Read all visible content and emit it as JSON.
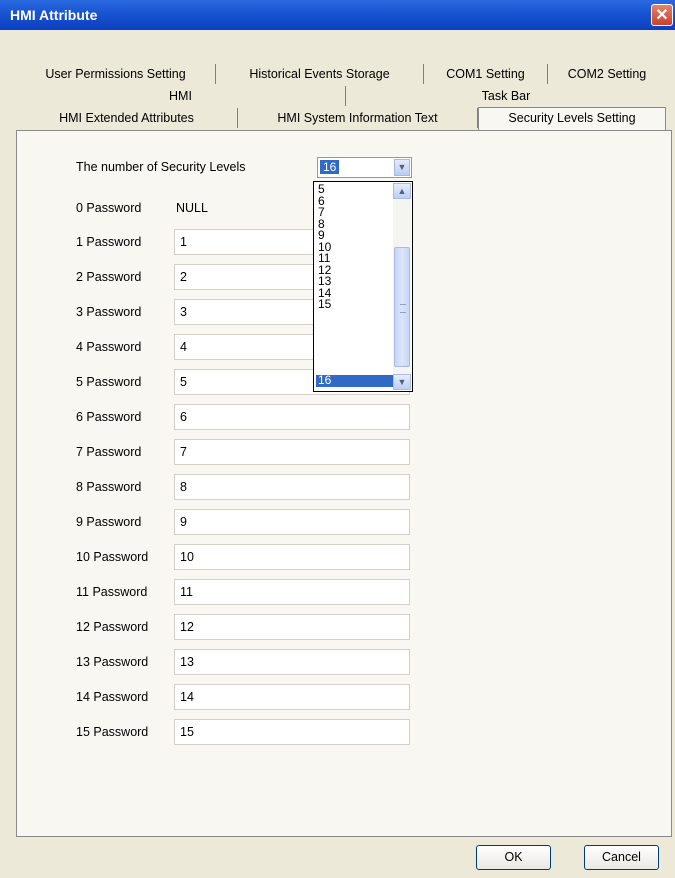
{
  "window": {
    "title": "HMI Attribute",
    "close_symbol": "✕"
  },
  "tabs": {
    "row1": [
      "User Permissions Setting",
      "Historical Events Storage",
      "COM1 Setting",
      "COM2 Setting"
    ],
    "row2": [
      "HMI",
      "Task Bar"
    ],
    "row3": [
      "HMI Extended Attributes",
      "HMI System Information Text",
      "Security Levels Setting"
    ],
    "active": "Security Levels Setting"
  },
  "security": {
    "levels_label": "The number of Security Levels",
    "levels_value": "16",
    "dropdown_options": [
      "5",
      "6",
      "7",
      "8",
      "9",
      "10",
      "11",
      "12",
      "13",
      "14",
      "15",
      "16"
    ],
    "dropdown_selected": "16",
    "password0_label": "0 Password",
    "password0_value": "NULL",
    "passwords": [
      {
        "label": "1 Password",
        "value": "1"
      },
      {
        "label": "2 Password",
        "value": "2"
      },
      {
        "label": "3 Password",
        "value": "3"
      },
      {
        "label": "4 Password",
        "value": "4"
      },
      {
        "label": "5 Password",
        "value": "5"
      },
      {
        "label": "6 Password",
        "value": "6"
      },
      {
        "label": "7 Password",
        "value": "7"
      },
      {
        "label": "8 Password",
        "value": "8"
      },
      {
        "label": "9 Password",
        "value": "9"
      },
      {
        "label": "10 Password",
        "value": "10"
      },
      {
        "label": "11 Password",
        "value": "11"
      },
      {
        "label": "12 Password",
        "value": "12"
      },
      {
        "label": "13 Password",
        "value": "13"
      },
      {
        "label": "14 Password",
        "value": "14"
      },
      {
        "label": "15 Password",
        "value": "15"
      }
    ]
  },
  "buttons": {
    "ok": "OK",
    "cancel": "Cancel"
  },
  "colors": {
    "titlebar": "#1b55d4",
    "selection": "#316ac5",
    "dialog_bg": "#ece9d8",
    "panel_bg": "#f8f7f2"
  }
}
